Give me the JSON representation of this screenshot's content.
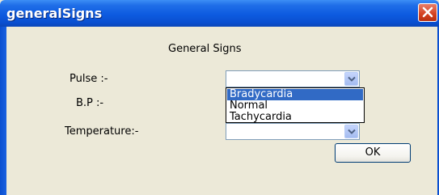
{
  "window": {
    "title": "generalSigns"
  },
  "form": {
    "heading": "General Signs",
    "pulse_label": "Pulse :-",
    "bp_label": "B.P :-",
    "temperature_label": "Temperature:-",
    "pulse_value": "",
    "temperature_value": ""
  },
  "dropdown": {
    "options": [
      "Bradycardia",
      "Normal",
      "Tachycardia"
    ],
    "selected": "Bradycardia"
  },
  "buttons": {
    "ok_label": "OK"
  },
  "colors": {
    "titlebar": "#0d5be0",
    "close": "#d4411f",
    "selection": "#316ac5",
    "dialog_bg": "#ece9d8"
  },
  "icons": {
    "close": "close-icon",
    "dropdown": "chevron-down-icon"
  }
}
